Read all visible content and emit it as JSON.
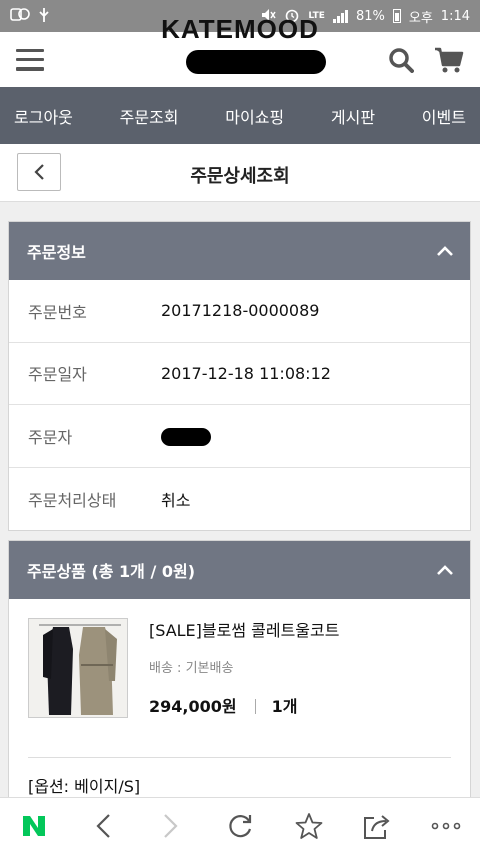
{
  "status_bar": {
    "battery": "81%",
    "time_label": "오후",
    "time": "1:14",
    "network": "LTE"
  },
  "header": {
    "logo_text": "KATEMOOD",
    "menu_icon": "hamburger-icon",
    "search_icon": "search-icon",
    "cart_icon": "cart-icon"
  },
  "nav": {
    "items": [
      "로그아웃",
      "주문조회",
      "마이쇼핑",
      "게시판",
      "이벤트"
    ]
  },
  "title_bar": {
    "title": "주문상세조회",
    "back_icon": "chevron-left-icon"
  },
  "order_info": {
    "heading": "주문정보",
    "rows": [
      {
        "label": "주문번호",
        "value": "20171218-0000089"
      },
      {
        "label": "주문일자",
        "value": "2017-12-18 11:08:12"
      },
      {
        "label": "주문자",
        "value": ""
      },
      {
        "label": "주문처리상태",
        "value": "취소"
      }
    ]
  },
  "order_items": {
    "heading": "주문상품 (총 1개 / 0원)",
    "product": {
      "name": "[SALE]블로썸 콜레트울코트",
      "shipping": "배송 : 기본배송",
      "price": "294,000원",
      "quantity": "1개",
      "option": "[옵션: 베이지/S]"
    }
  },
  "browser_bar": {
    "icons": [
      "naver-icon",
      "back-icon",
      "forward-icon",
      "refresh-icon",
      "bookmark-star-icon",
      "share-icon",
      "more-icon"
    ]
  },
  "colors": {
    "nav_bg": "#5b616c",
    "section_header_bg": "#707683",
    "naver_green": "#03c75a"
  }
}
